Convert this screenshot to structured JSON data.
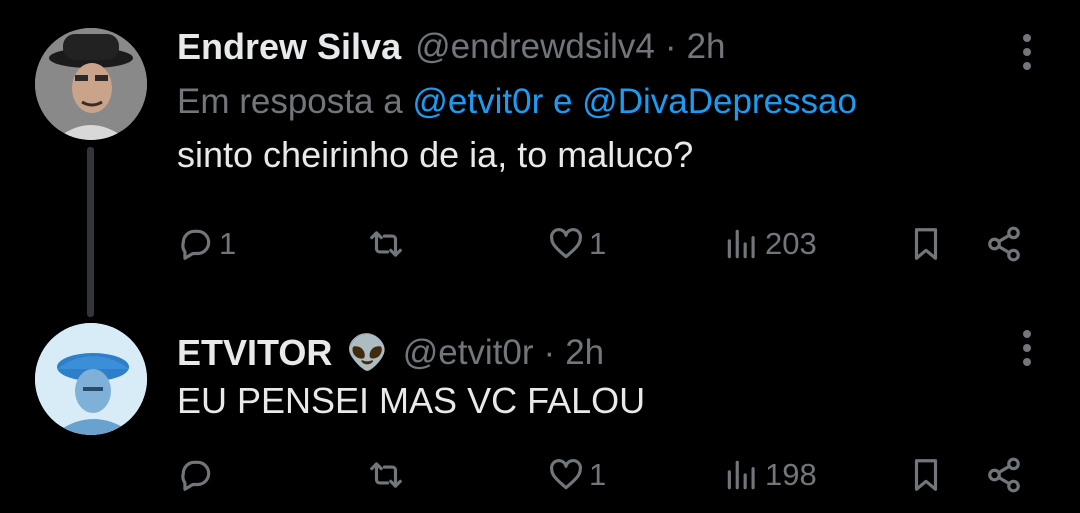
{
  "tweets": [
    {
      "author_name": "Endrew Silva",
      "emoji": "",
      "handle": "@endrewdsilv4",
      "separator": "·",
      "time": "2h",
      "replying_prefix": "Em resposta a",
      "replying_mention_1": "@etvit0r",
      "replying_conjunction": "e",
      "replying_mention_2": "@DivaDepressao",
      "text": "sinto cheirinho de ia, to maluco?",
      "reply_count": "1",
      "retweet_count": "",
      "like_count": "1",
      "view_count": "203"
    },
    {
      "author_name": "ETVITOR",
      "emoji": "👽",
      "handle": "@etvit0r",
      "separator": "·",
      "time": "2h",
      "text": "EU PENSEI MAS VC FALOU",
      "reply_count": "",
      "retweet_count": "",
      "like_count": "1",
      "view_count": "198"
    }
  ],
  "colors": {
    "background": "#000000",
    "primary_text": "#e7e9ea",
    "secondary_text": "#71767b",
    "link": "#1d9bf0",
    "thread_line": "#333639"
  },
  "icons": [
    "reply-icon",
    "retweet-icon",
    "like-icon",
    "views-icon",
    "bookmark-icon",
    "share-icon",
    "more-options-icon"
  ]
}
